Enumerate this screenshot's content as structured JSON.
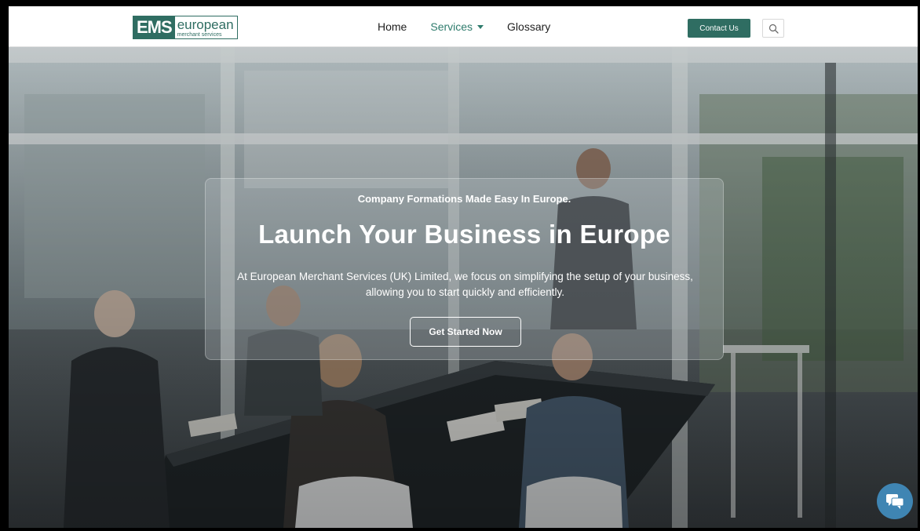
{
  "brand": {
    "mark": "EMS",
    "word": "european",
    "subtitle": "merchant services",
    "accent_color": "#2f6d62"
  },
  "nav": {
    "items": [
      {
        "label": "Home"
      },
      {
        "label": "Services"
      },
      {
        "label": "Glossary"
      }
    ],
    "active_item": "Services"
  },
  "header": {
    "contact_label": "Contact Us",
    "search_icon": "search-icon"
  },
  "hero": {
    "kicker": "Company Formations Made Easy In Europe.",
    "headline": "Launch Your Business in Europe",
    "description": "At European Merchant Services (UK) Limited, we focus on simplifying the setup of your business, allowing you to start quickly and efficiently.",
    "cta_label": "Get Started Now"
  },
  "chat": {
    "icon": "chat-icon",
    "color": "#3f85b3"
  }
}
